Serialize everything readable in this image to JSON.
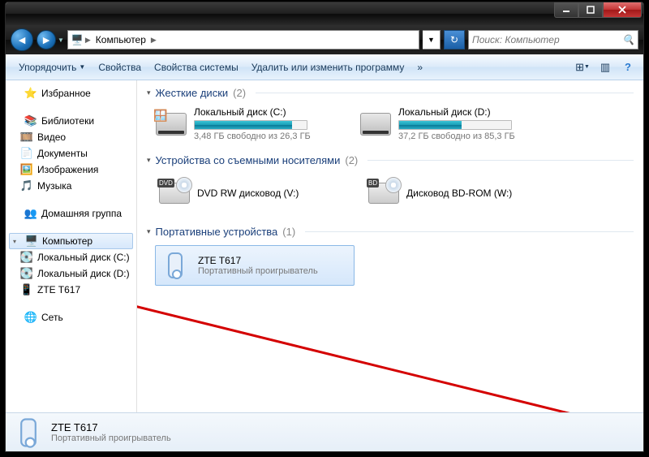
{
  "window": {
    "breadcrumb_root_icon": "computer-icon",
    "breadcrumb": "Компьютер",
    "search_placeholder": "Поиск: Компьютер"
  },
  "toolbar": {
    "organize": "Упорядочить",
    "properties": "Свойства",
    "system_properties": "Свойства системы",
    "uninstall_change": "Удалить или изменить программу"
  },
  "sidebar": {
    "favorites": "Избранное",
    "libraries": "Библиотеки",
    "lib_items": [
      "Видео",
      "Документы",
      "Изображения",
      "Музыка"
    ],
    "homegroup": "Домашняя группа",
    "computer": "Компьютер",
    "comp_items": [
      "Локальный диск (C:)",
      "Локальный диск (D:)",
      "ZTE T617"
    ],
    "network": "Сеть"
  },
  "content": {
    "categories": [
      {
        "title": "Жесткие диски",
        "count": "(2)",
        "drives": [
          {
            "name": "Локальный диск (C:)",
            "free": "3,48 ГБ свободно из 26,3 ГБ",
            "fill_pct": 87
          },
          {
            "name": "Локальный диск (D:)",
            "free": "37,2 ГБ свободно из 85,3 ГБ",
            "fill_pct": 56
          }
        ]
      },
      {
        "title": "Устройства со съемными носителями",
        "count": "(2)",
        "devices": [
          {
            "name": "DVD RW дисковод (V:)",
            "badge": "DVD"
          },
          {
            "name": "Дисковод BD-ROM (W:)",
            "badge": "BD"
          }
        ]
      },
      {
        "title": "Портативные устройства",
        "count": "(1)",
        "portable": [
          {
            "name": "ZTE T617",
            "type": "Портативный проигрыватель",
            "selected": true
          }
        ]
      }
    ]
  },
  "details": {
    "name": "ZTE T617",
    "type": "Портативный проигрыватель"
  }
}
